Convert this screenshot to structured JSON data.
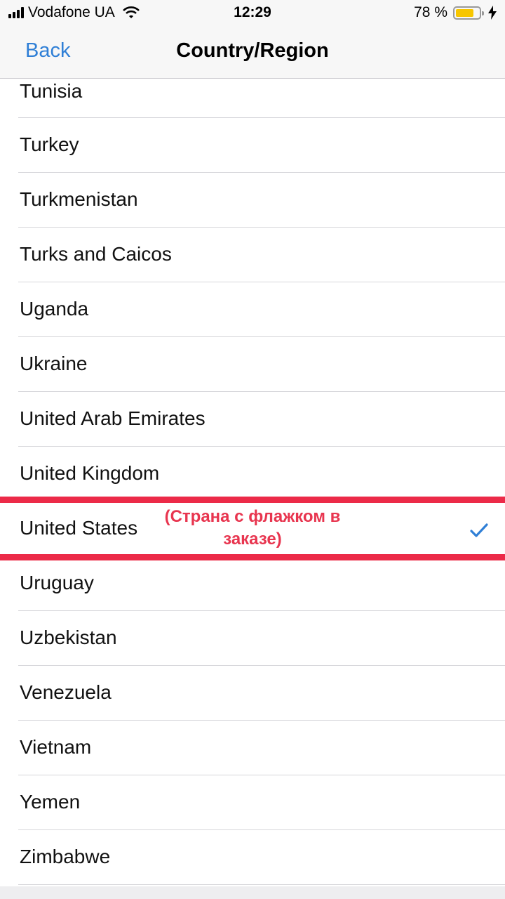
{
  "status_bar": {
    "carrier": "Vodafone UA",
    "time": "12:29",
    "battery_percent_label": "78 %",
    "battery_level": 0.78,
    "battery_color": "#f7c600",
    "icons": [
      "signal-icon",
      "wifi-icon",
      "battery-icon",
      "charging-bolt-icon"
    ]
  },
  "nav": {
    "back_label": "Back",
    "title": "Country/Region",
    "accent_color": "#2f7fd6"
  },
  "countries": [
    {
      "name": "Tunisia",
      "selected": false
    },
    {
      "name": "Turkey",
      "selected": false
    },
    {
      "name": "Turkmenistan",
      "selected": false
    },
    {
      "name": "Turks and Caicos",
      "selected": false
    },
    {
      "name": "Uganda",
      "selected": false
    },
    {
      "name": "Ukraine",
      "selected": false
    },
    {
      "name": "United Arab Emirates",
      "selected": false
    },
    {
      "name": "United Kingdom",
      "selected": false
    },
    {
      "name": "United States",
      "selected": true
    },
    {
      "name": "Uruguay",
      "selected": false
    },
    {
      "name": "Uzbekistan",
      "selected": false
    },
    {
      "name": "Venezuela",
      "selected": false
    },
    {
      "name": "Vietnam",
      "selected": false
    },
    {
      "name": "Yemen",
      "selected": false
    },
    {
      "name": "Zimbabwe",
      "selected": false
    }
  ],
  "annotation": {
    "line1": "(Страна с флажком в",
    "line2": "заказе)",
    "color": "#e8354f"
  }
}
